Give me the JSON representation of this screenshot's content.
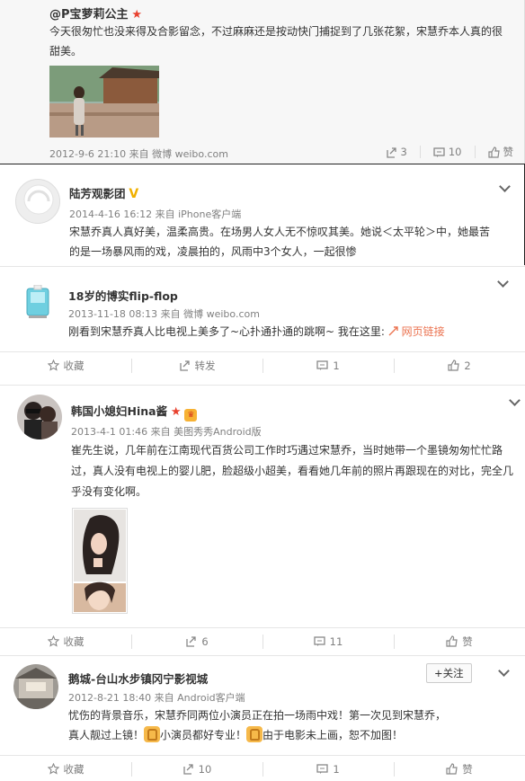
{
  "post1": {
    "author": "@P宝萝莉公主",
    "text": "今天很匆忙也没来得及合影留念，不过麻麻还是按动快门捕捉到了几张花絮，宋慧乔本人真的很甜美。",
    "meta": "2012-9-6 21:10 来自 微博 weibo.com",
    "share_count": "3",
    "comment_count": "10",
    "like_label": "赞"
  },
  "post2": {
    "author": "陆芳观影团",
    "meta": "2014-4-16 16:12 来自 iPhone客户端",
    "text": "宋慧乔真人真好美，温柔高贵。在场男人女人无不惊叹其美。她说＜太平轮＞中，她最苦的是一场暴风雨的戏，凌晨拍的，风雨中3个女人，一起很惨"
  },
  "post3": {
    "author": "18岁的博实flip-flop",
    "meta": "2013-11-18 08:13 来自 微博 weibo.com",
    "text": "刚看到宋慧乔真人比电视上美多了~心扑通扑通的跳啊~ 我在这里:",
    "link_label": "网页链接",
    "actions": {
      "fav": "收藏",
      "repost": "转发",
      "comment": "1",
      "like": "2"
    }
  },
  "post4": {
    "author": "韩国小媳妇Hina酱",
    "meta": "2013-4-1 01:46 来自 美图秀秀Android版",
    "text": "崔先生说，几年前在江南现代百货公司工作时巧遇过宋慧乔，当时她带一个墨镜匆匆忙忙路过，真人没有电视上的婴儿肥，脸超级小超美，看看她几年前的照片再跟现在的对比，完全几乎没有变化啊。",
    "actions": {
      "fav": "收藏",
      "repost": "6",
      "comment": "11",
      "like": "赞"
    }
  },
  "post5": {
    "author": "鹅城-台山水步镇冈宁影视城",
    "follow_label": "+关注",
    "meta": "2012-8-21 18:40 来自 Android客户端",
    "text_a": "忧伤的背景音乐，宋慧乔同两位小演员正在拍一场雨中戏！第一次见到宋慧乔，",
    "text_b1": "真人靓过上镜！",
    "text_b2": "小演员都好专业！",
    "text_b3": "由于电影未上画，恕不加图！",
    "actions": {
      "fav": "收藏",
      "repost": "10",
      "comment": "1",
      "like": "赞"
    }
  },
  "colors": {
    "link": "#eb7350",
    "star": "#e8412e",
    "muted": "#808080"
  }
}
